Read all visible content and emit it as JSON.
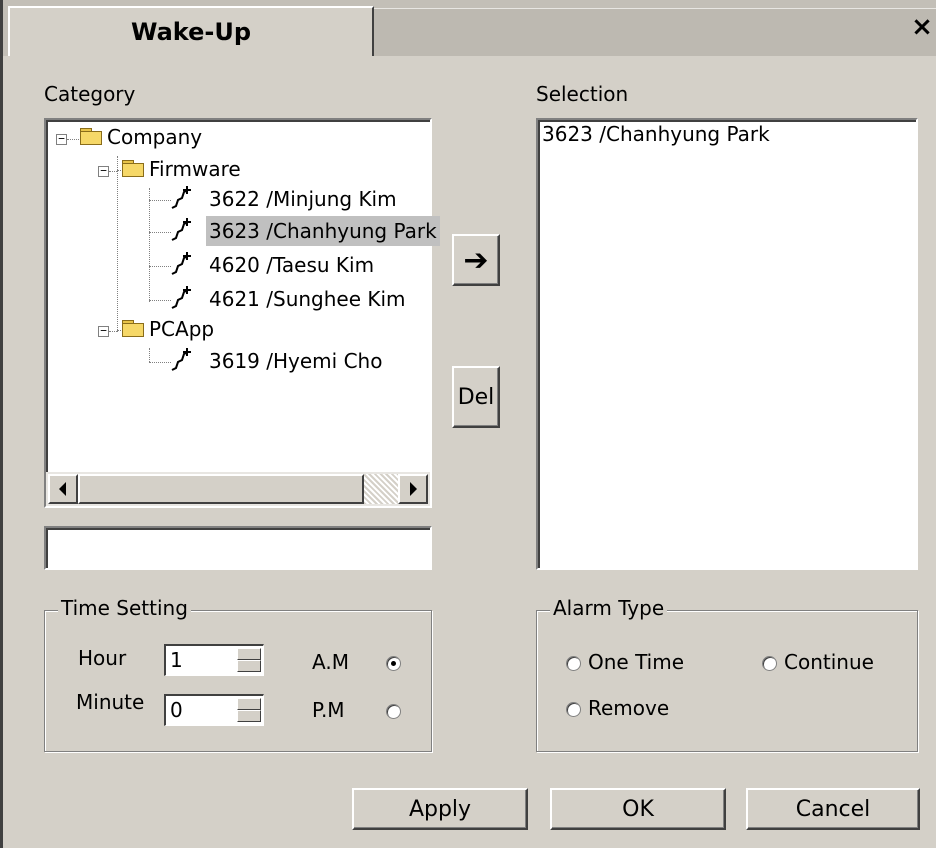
{
  "window": {
    "title": "Wake-Up",
    "close_glyph": "×"
  },
  "category": {
    "label": "Category",
    "tree": [
      {
        "text": "Company"
      },
      {
        "text": "Firmware"
      },
      {
        "text": "3622 /Minjung Kim"
      },
      {
        "text": "3623 /Chanhyung Park",
        "selected": true
      },
      {
        "text": "4620 /Taesu Kim"
      },
      {
        "text": "4621 /Sunghee Kim"
      },
      {
        "text": "PCApp"
      },
      {
        "text": "3619 /Hyemi Cho"
      }
    ],
    "filter_value": ""
  },
  "actions": {
    "add_glyph": "➔",
    "del_label": "Del"
  },
  "selection": {
    "label": "Selection",
    "items": [
      "3623 /Chanhyung Park"
    ]
  },
  "time_setting": {
    "legend": "Time Setting",
    "hour_label": "Hour",
    "hour_value": "1",
    "minute_label": "Minute",
    "minute_value": "0",
    "am_label": "A.M",
    "pm_label": "P.M",
    "selected": "A.M"
  },
  "alarm_type": {
    "legend": "Alarm Type",
    "options": [
      "One Time",
      "Continue",
      "Remove"
    ]
  },
  "footer": {
    "apply_label": "Apply",
    "ok_label": "OK",
    "cancel_label": "Cancel"
  }
}
